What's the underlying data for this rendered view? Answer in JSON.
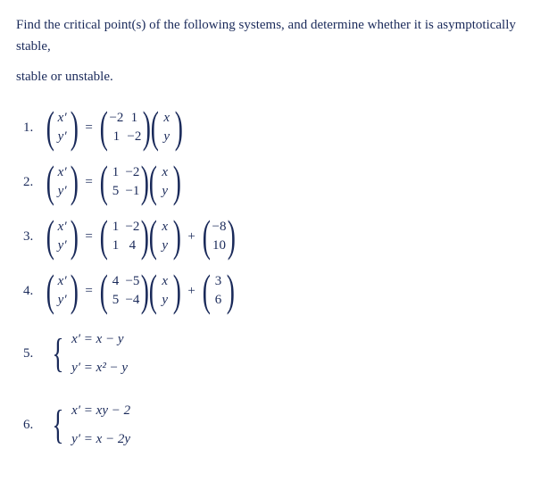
{
  "intro": {
    "line1": "Find the critical point(s) of the following systems, and determine whether it is asymptotically stable,",
    "line2": "stable or unstable."
  },
  "items": [
    {
      "num": "1.",
      "type": "matrix",
      "lhs": {
        "r1": "x′",
        "r2": "y′"
      },
      "eq": "=",
      "matrix": {
        "a11": "−2",
        "a12": "1",
        "a21": "1",
        "a22": "−2"
      },
      "vec": {
        "r1": "x",
        "r2": "y"
      }
    },
    {
      "num": "2.",
      "type": "matrix",
      "lhs": {
        "r1": "x′",
        "r2": "y′"
      },
      "eq": "=",
      "matrix": {
        "a11": "1",
        "a12": "−2",
        "a21": "5",
        "a22": "−1"
      },
      "vec": {
        "r1": "x",
        "r2": "y"
      }
    },
    {
      "num": "3.",
      "type": "matrix_plus",
      "lhs": {
        "r1": "x′",
        "r2": "y′"
      },
      "eq": "=",
      "matrix": {
        "a11": "1",
        "a12": "−2",
        "a21": "1",
        "a22": "4"
      },
      "vec": {
        "r1": "x",
        "r2": "y"
      },
      "plus": "+",
      "const": {
        "r1": "−8",
        "r2": "10"
      }
    },
    {
      "num": "4.",
      "type": "matrix_plus",
      "lhs": {
        "r1": "x′",
        "r2": "y′"
      },
      "eq": "=",
      "matrix": {
        "a11": "4",
        "a12": "−5",
        "a21": "5",
        "a22": "−4"
      },
      "vec": {
        "r1": "x",
        "r2": "y"
      },
      "plus": "+",
      "const": {
        "r1": "3",
        "r2": "6"
      }
    },
    {
      "num": "5.",
      "type": "system",
      "eq1": "x′ = x − y",
      "eq2": "y′ = x² − y"
    },
    {
      "num": "6.",
      "type": "system",
      "eq1": "x′ = xy − 2",
      "eq2": "y′ = x − 2y"
    }
  ]
}
